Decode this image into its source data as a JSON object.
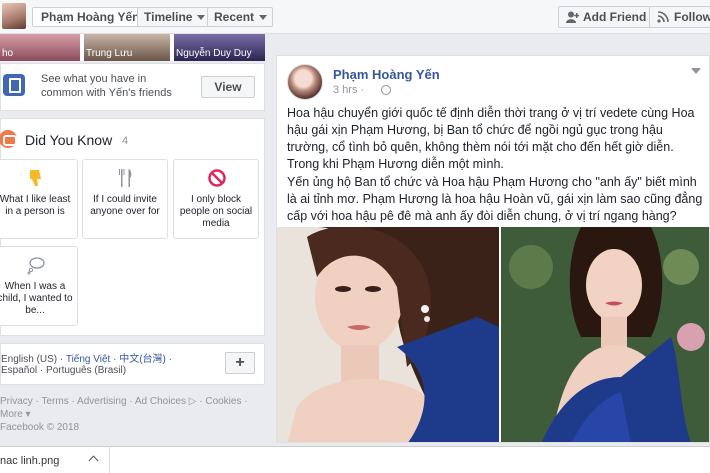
{
  "header": {
    "profile_name": "Phạm Hoàng Yến",
    "timeline_label": "Timeline",
    "recent_label": "Recent",
    "add_friend_label": "Add Friend",
    "follow_label": "Follow"
  },
  "photos": [
    {
      "label": "ho"
    },
    {
      "label": "Trung Lưu"
    },
    {
      "label": "Nguyễn Duy Duy"
    }
  ],
  "common": {
    "text": "See what you have in common with Yến's friends",
    "view_label": "View"
  },
  "did_you_know": {
    "title": "Did You Know",
    "count": "4",
    "tiles": [
      {
        "text": "What I like least in a person is",
        "icon": "thumbs-down-icon"
      },
      {
        "text": "If I could invite anyone over for",
        "icon": "fork-knife-icon"
      },
      {
        "text": "I only block people on social media",
        "icon": "block-icon"
      },
      {
        "text": "When I was a child, I wanted to be...",
        "icon": "thought-bubble-icon"
      }
    ]
  },
  "languages": {
    "current": "English (US)",
    "line1_others": "· Tiếng Việt · 中文(台灣) ·",
    "line2": "Español · Português (Brasil)",
    "add_label": "+"
  },
  "footer": {
    "line1": "Privacy · Terms · Advertising · Ad Choices ▷ · Cookies ·",
    "line2": "More ▾",
    "line3": "Facebook © 2018"
  },
  "post": {
    "author": "Phạm Hoàng Yến",
    "time": "3 hrs ·",
    "paragraph1": "Hoa hậu chuyển giới quốc tế định diễn thời trang ở vị trí vedete cùng Hoa hậu gái xịn Phạm Hương, bị Ban tổ chức để ngồi ngủ gục trong hậu trường, cổ tình bỏ quên, không thèm nói tới mặt cho đến hết giờ diễn. Trong khi Phạm Hương diễn một mình.",
    "paragraph2": "Yến ủng hộ Ban tổ chức và Hoa hậu Phạm Hương cho \"anh ấy\" biết mình là ai tỉnh mơ. Phạm Hương là hoa hậu Hoàn vũ, gái xịn làm sao cũng đẳng cấp với hoa hậu pê đê mà anh ấy đòi diễn chung, ở vị trí ngang hàng?"
  },
  "downloads": {
    "file_name": "nac linh.png"
  },
  "colors": {
    "link_blue": "#365899",
    "background": "#e9ebee",
    "dress_blue": "#1e3a8a"
  }
}
